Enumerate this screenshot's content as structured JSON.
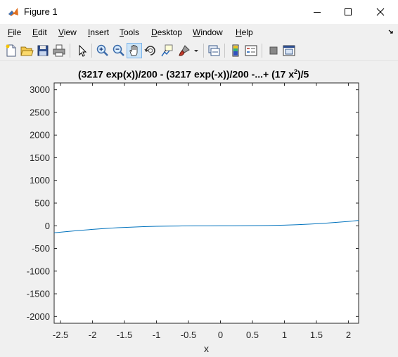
{
  "window": {
    "title": "Figure 1",
    "controls": {
      "minimize": "minimize",
      "maximize": "maximize",
      "close": "close"
    }
  },
  "menu": {
    "items": [
      {
        "label": "File",
        "accel": "F",
        "rest": "ile"
      },
      {
        "label": "Edit",
        "accel": "E",
        "rest": "dit"
      },
      {
        "label": "View",
        "accel": "V",
        "rest": "iew"
      },
      {
        "label": "Insert",
        "accel": "I",
        "rest": "nsert"
      },
      {
        "label": "Tools",
        "accel": "T",
        "rest": "ools"
      },
      {
        "label": "Desktop",
        "accel": "D",
        "rest": "esktop"
      },
      {
        "label": "Window",
        "accel": "W",
        "rest": "indow"
      },
      {
        "label": "Help",
        "accel": "H",
        "rest": "elp"
      }
    ],
    "overflow_icon": "dock-arrow-icon"
  },
  "toolbar": {
    "buttons": [
      "new-figure-icon",
      "open-file-icon",
      "save-icon",
      "print-icon",
      "pointer-icon",
      "zoom-in-icon",
      "zoom-out-icon",
      "pan-hand-icon",
      "rotate-3d-icon",
      "data-cursor-icon",
      "brush-icon",
      "brush-dropdown-icon",
      "link-plot-icon",
      "colorbar-icon",
      "legend-icon",
      "hide-plot-tools-icon",
      "show-plot-tools-icon"
    ],
    "active": "pan-hand-icon"
  },
  "chart_data": {
    "type": "line",
    "title_main": "(3217 exp(x))/200 - (3217 exp(-x))/200 -...+ (17 x",
    "title_sup": "2",
    "title_tail": ")/5",
    "xlabel": "x",
    "ylabel": "",
    "xlim": [
      -2.6,
      2.16
    ],
    "ylim": [
      -2150,
      3150
    ],
    "xticks": [
      -2.5,
      -2,
      -1.5,
      -1,
      -0.5,
      0,
      0.5,
      1,
      1.5,
      2
    ],
    "xtick_labels": [
      "-2.5",
      "-2",
      "-1.5",
      "-1",
      "-0.5",
      "0",
      "0.5",
      "1",
      "1.5",
      "2"
    ],
    "yticks": [
      3000,
      2500,
      2000,
      1500,
      1000,
      500,
      0,
      -500,
      -1000,
      -1500,
      -2000
    ],
    "ytick_labels": [
      "3000",
      "2500",
      "2000",
      "1500",
      "1000",
      "500",
      "0",
      "-500",
      "-1000",
      "-1500",
      "-2000"
    ],
    "series": [
      {
        "color": "#0072bd",
        "x": [
          -2.6,
          -2.4,
          -2.2,
          -2.0,
          -1.8,
          -1.6,
          -1.4,
          -1.2,
          -1.0,
          -0.8,
          -0.6,
          -0.4,
          -0.2,
          0.0,
          0.2,
          0.4,
          0.6,
          0.8,
          1.0,
          1.2,
          1.4,
          1.6,
          1.8,
          2.0,
          2.16
        ],
        "y": [
          -155,
          -128,
          -103,
          -80,
          -60,
          -43,
          -30,
          -20,
          -12,
          -7,
          -4,
          -2,
          -1,
          0,
          1,
          2,
          4,
          7,
          14,
          24,
          37,
          53,
          73,
          96,
          117
        ]
      }
    ],
    "grid": false
  }
}
